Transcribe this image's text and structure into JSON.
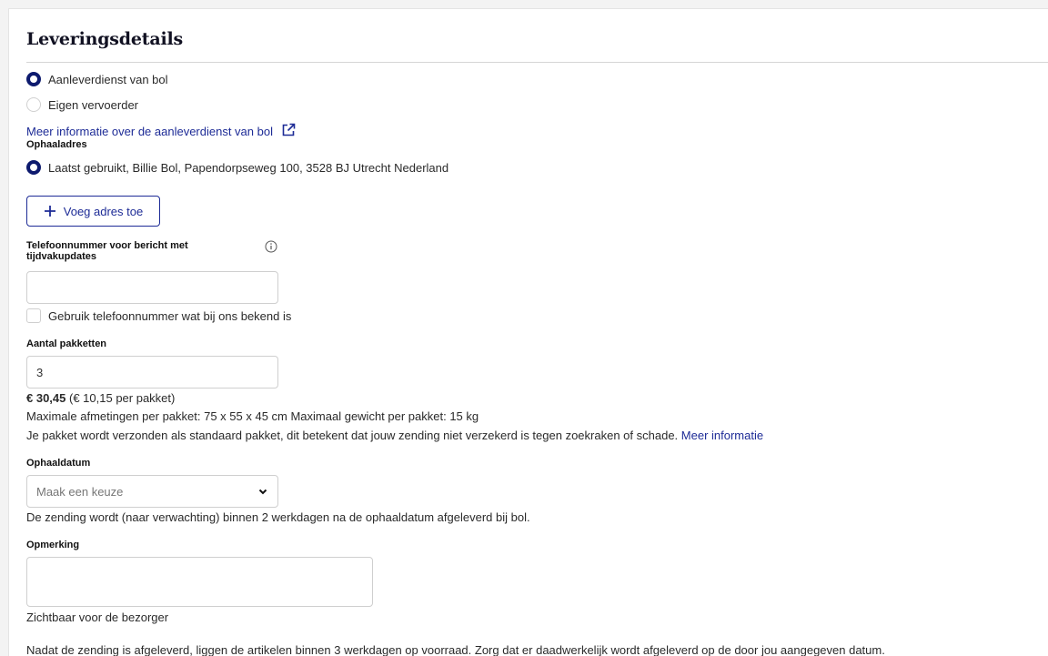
{
  "heading": "Leveringsdetails",
  "delivery_options": [
    {
      "label": "Aanleverdienst van bol",
      "selected": true
    },
    {
      "label": "Eigen vervoerder",
      "selected": false
    }
  ],
  "info_link": "Meer informatie over de aanleverdienst van bol",
  "pickup_address": {
    "label": "Ophaaladres",
    "option": "Laatst gebruikt, Billie Bol, Papendorpseweg 100, 3528 BJ Utrecht Nederland",
    "add_button": "Voeg adres toe"
  },
  "phone": {
    "label_line1": "Telefoonnummer voor bericht met",
    "label_line2": "tijdvakupdates",
    "value": "",
    "checkbox_label": "Gebruik telefoonnummer wat bij ons bekend is"
  },
  "packages": {
    "label": "Aantal pakketten",
    "value": "3",
    "price": "€ 30,45",
    "price_detail": "(€ 10,15 per pakket)",
    "dimensions": "Maximale afmetingen per pakket: 75 x 55 x 45 cm Maximaal gewicht per pakket: 15 kg",
    "insurance_note": "Je pakket wordt verzonden als standaard pakket, dit betekent dat jouw zending niet verzekerd is tegen zoekraken of schade.",
    "insurance_link": "Meer informatie"
  },
  "pickup_date": {
    "label": "Ophaaldatum",
    "placeholder": "Maak een keuze",
    "note": "De zending wordt (naar verwachting) binnen 2 werkdagen na de ophaaldatum afgeleverd bij bol."
  },
  "remark": {
    "label": "Opmerking",
    "value": "",
    "hint": "Zichtbaar voor de bezorger"
  },
  "footer_note": "Nadat de zending is afgeleverd, liggen de artikelen binnen 3 werkdagen op voorraad. Zorg dat er daadwerkelijk wordt afgeleverd op de door jou aangegeven datum.",
  "colors": {
    "accent": "#1d2b96",
    "radio_checked": "#0d1a6e"
  }
}
